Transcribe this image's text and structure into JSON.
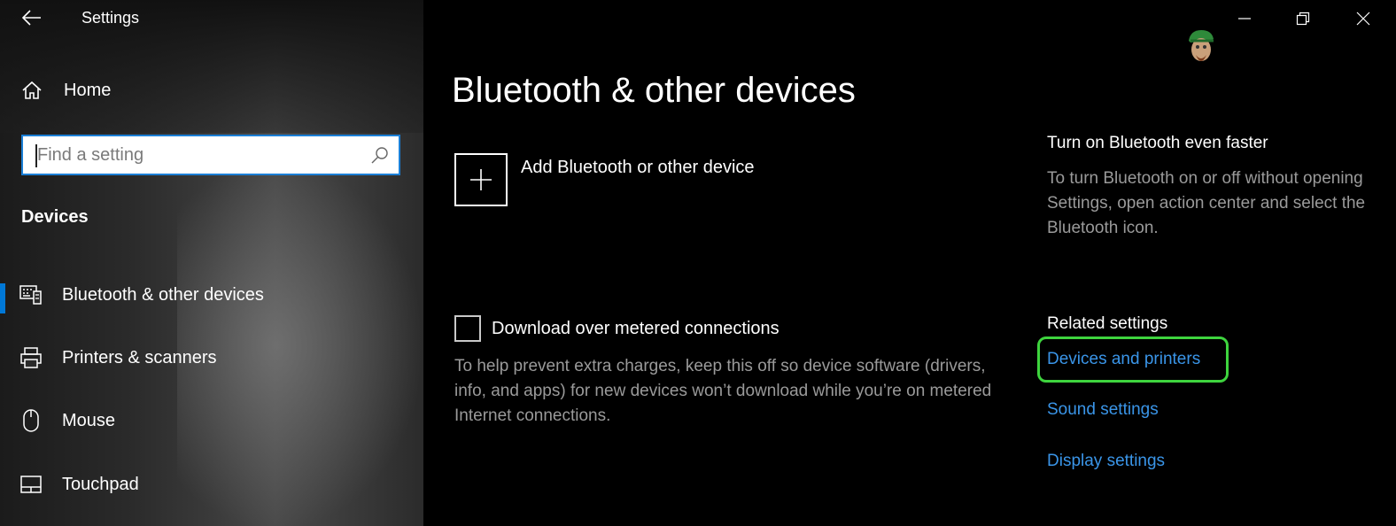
{
  "window": {
    "title": "Settings",
    "controls": {
      "minimize": "minimize-icon",
      "restore": "restore-icon",
      "close": "close-icon"
    }
  },
  "sidebar": {
    "home_label": "Home",
    "search": {
      "placeholder": "Find a setting",
      "value": ""
    },
    "section_heading": "Devices",
    "items": [
      {
        "label": "Bluetooth & other devices",
        "icon": "bluetooth-keyboard-icon",
        "active": true
      },
      {
        "label": "Printers & scanners",
        "icon": "printer-icon",
        "active": false
      },
      {
        "label": "Mouse",
        "icon": "mouse-icon",
        "active": false
      },
      {
        "label": "Touchpad",
        "icon": "touchpad-icon",
        "active": false
      }
    ]
  },
  "main": {
    "title": "Bluetooth & other devices",
    "add_device_label": "Add Bluetooth or other device",
    "metered": {
      "label": "Download over metered connections",
      "checked": false,
      "description": "To help prevent extra charges, keep this off so device software (drivers, info, and apps) for new devices won’t download while you’re on metered Internet connections."
    }
  },
  "side_panel": {
    "tip_title": "Turn on Bluetooth even faster",
    "tip_text": "To turn Bluetooth on or off without opening Settings, open action center and select the Bluetooth icon.",
    "related_heading": "Related settings",
    "links": [
      "Devices and printers",
      "Sound settings",
      "Display settings"
    ]
  },
  "colors": {
    "accent": "#0078d7",
    "link": "#3a95e8",
    "highlight": "#3ed43e",
    "muted_text": "#9a9a9a"
  }
}
